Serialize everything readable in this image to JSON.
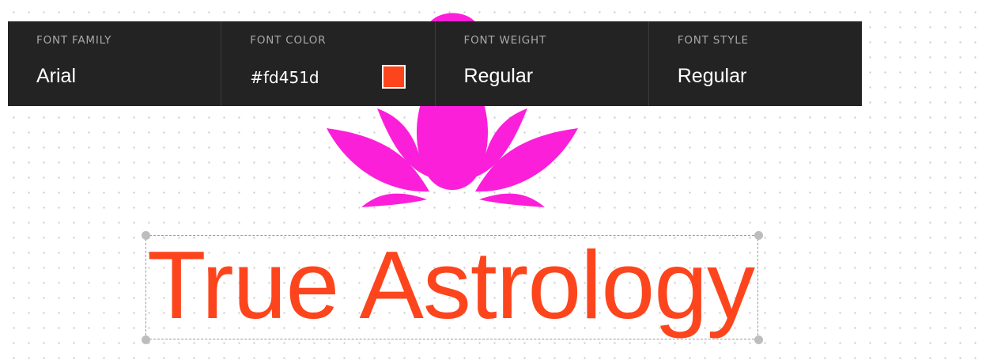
{
  "toolbar": {
    "font_family": {
      "label": "FONT FAMILY",
      "value": "Arial"
    },
    "font_color": {
      "label": "FONT COLOR",
      "value": "#fd451d",
      "swatch_color": "#fd451d"
    },
    "font_weight": {
      "label": "FONT WEIGHT",
      "value": "Regular"
    },
    "font_style": {
      "label": "FONT STYLE",
      "value": "Regular"
    }
  },
  "canvas": {
    "logo": {
      "icon": "lotus-icon",
      "color": "#fc1fd9"
    },
    "text_element": {
      "text": "True Astrology",
      "color": "#fd451d"
    }
  },
  "colors": {
    "toolbar_bg": "#232323",
    "toolbar_label": "#a8a8a8",
    "canvas_bg": "#ffffff"
  }
}
